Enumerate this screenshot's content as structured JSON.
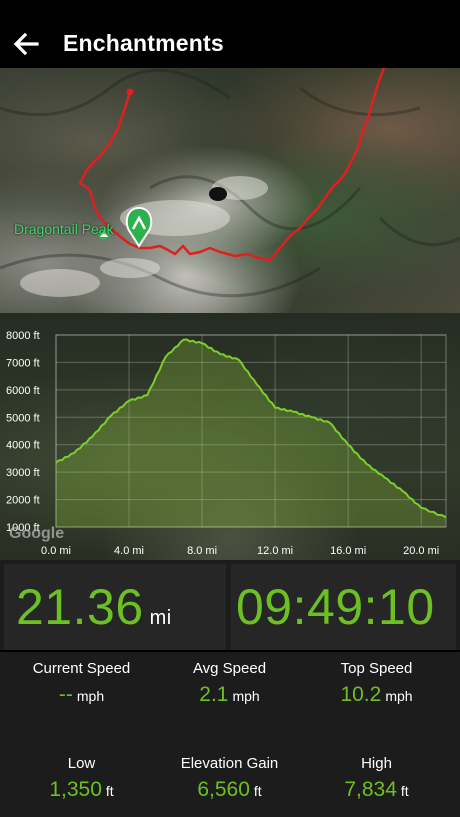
{
  "header": {
    "title": "Enchantments",
    "back_icon": "arrow-left-icon"
  },
  "map": {
    "poi_label": "Dragontail Peak",
    "route_color": "#e01f1f",
    "marker_color": "#2bb24c"
  },
  "chart_data": {
    "type": "area",
    "xlabel": "",
    "ylabel": "",
    "x_ticks": [
      "0.0 mi",
      "4.0 mi",
      "8.0 mi",
      "12.0 mi",
      "16.0 mi",
      "20.0 mi"
    ],
    "y_ticks": [
      "1000 ft",
      "2000 ft",
      "3000 ft",
      "4000 ft",
      "5000 ft",
      "6000 ft",
      "7000 ft",
      "8000 ft"
    ],
    "xlim": [
      0,
      21.36
    ],
    "ylim": [
      1000,
      8000
    ],
    "x": [
      0,
      1,
      2,
      3,
      4,
      5,
      6,
      7,
      8,
      9,
      10,
      11,
      12,
      13,
      14,
      15,
      16,
      17,
      18,
      19,
      20,
      21.36
    ],
    "y": [
      3350,
      3700,
      4300,
      5050,
      5600,
      5800,
      7200,
      7834,
      7700,
      7300,
      7100,
      6200,
      5350,
      5200,
      5000,
      4800,
      4000,
      3300,
      2800,
      2300,
      1700,
      1350
    ],
    "line_color": "#7ccf2a"
  },
  "stats": {
    "distance": {
      "value": "21.36",
      "unit": "mi"
    },
    "time": {
      "value": "09:49:10"
    },
    "current_speed": {
      "label": "Current Speed",
      "value": "--",
      "unit": "mph"
    },
    "avg_speed": {
      "label": "Avg Speed",
      "value": "2.1",
      "unit": "mph"
    },
    "top_speed": {
      "label": "Top Speed",
      "value": "10.2",
      "unit": "mph"
    },
    "low": {
      "label": "Low",
      "value": "1,350",
      "unit": "ft"
    },
    "elevation_gain": {
      "label": "Elevation Gain",
      "value": "6,560",
      "unit": "ft"
    },
    "high": {
      "label": "High",
      "value": "7,834",
      "unit": "ft"
    }
  },
  "colors": {
    "accent": "#6cc024",
    "panel": "#262626",
    "background": "#1c1c1c"
  }
}
